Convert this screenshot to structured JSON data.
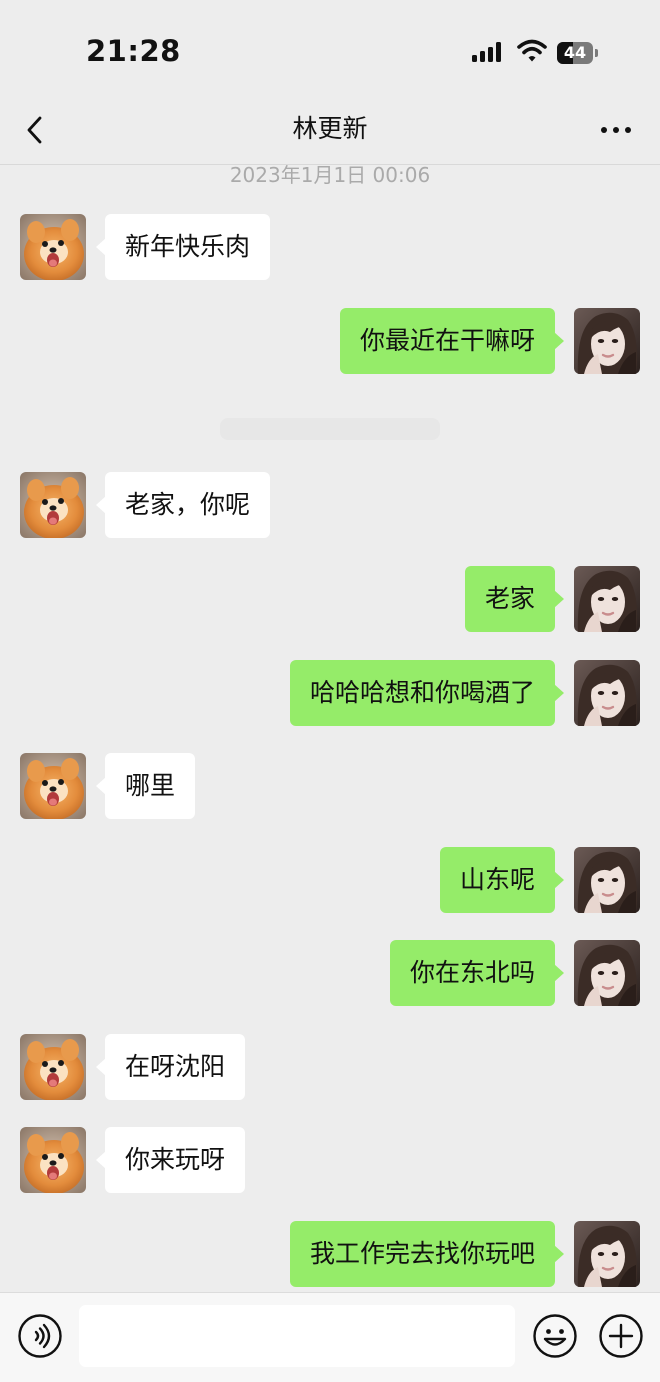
{
  "status_bar": {
    "time": "21:28",
    "battery_text": "44",
    "battery_level": 0.44
  },
  "header": {
    "title": "林更新",
    "back_icon": "chevron-left-icon",
    "more_icon": "more-dots-icon"
  },
  "chat": {
    "timestamp": "2023年1月1日 00:06",
    "messages": [
      {
        "side": "left",
        "text": "新年快乐肉"
      },
      {
        "side": "right",
        "text": "你最近在干嘛呀"
      },
      {
        "side": "left",
        "text": "老家，你呢"
      },
      {
        "side": "right",
        "text": "老家"
      },
      {
        "side": "right",
        "text": "哈哈哈想和你喝酒了"
      },
      {
        "side": "left",
        "text": "哪里"
      },
      {
        "side": "right",
        "text": "山东呢"
      },
      {
        "side": "right",
        "text": "你在东北吗"
      },
      {
        "side": "left",
        "text": "在呀沈阳"
      },
      {
        "side": "left",
        "text": "你来玩呀"
      },
      {
        "side": "right",
        "text": "我工作完去找你玩吧"
      }
    ]
  },
  "input_bar": {
    "value": "",
    "voice_icon": "voice-icon",
    "emoji_icon": "emoji-icon",
    "plus_icon": "plus-icon"
  },
  "colors": {
    "background": "#ededed",
    "sent_bubble": "#95ec69",
    "received_bubble": "#ffffff"
  }
}
